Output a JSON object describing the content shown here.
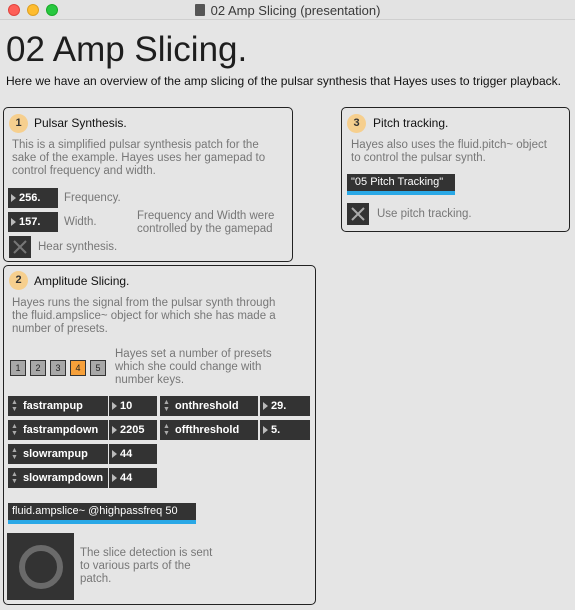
{
  "window": {
    "title": "02 Amp Slicing (presentation)"
  },
  "heading": "02 Amp Slicing.",
  "intro": "Here we have an overview of the amp slicing of the pulsar synthesis that Hayes uses to trigger playback.",
  "panel1": {
    "number": "1",
    "title": "Pulsar Synthesis.",
    "desc": [
      "This is a simplified pulsar synthesis patch for the",
      "sake of the example. Hayes uses her gamepad to",
      "control frequency and width."
    ],
    "frequency_value": "256.",
    "frequency_label": "Frequency.",
    "width_value": "157.",
    "width_label": "Width.",
    "note": [
      "Frequency and Width were",
      "controlled by the gamepad"
    ],
    "hear_label": "Hear synthesis."
  },
  "panel2": {
    "number": "2",
    "title": "Amplitude Slicing.",
    "desc": [
      "Hayes runs the signal from the pulsar synth through",
      "the fluid.ampslice~ object for which she has made a",
      "number of presets."
    ],
    "presets": [
      "1",
      "2",
      "3",
      "4",
      "5"
    ],
    "active_preset": "4",
    "preset_note": [
      "Hayes set a number of presets",
      "which she could change with",
      "number keys."
    ],
    "params": [
      {
        "name": "fastrampup",
        "value": "10"
      },
      {
        "name": "fastrampdown",
        "value": "2205"
      },
      {
        "name": "slowrampup",
        "value": "44"
      },
      {
        "name": "slowrampdown",
        "value": "44"
      },
      {
        "name": "onthreshold",
        "value": "29."
      },
      {
        "name": "offthreshold",
        "value": "5."
      }
    ],
    "object": "fluid.ampslice~ @highpassfreq 50",
    "slice_note": [
      "The slice detection is sent",
      "to various parts of the",
      "patch."
    ]
  },
  "panel3": {
    "number": "3",
    "title": "Pitch tracking.",
    "desc": [
      "Hayes also uses the fluid.pitch~ object",
      "to control the pulsar synth."
    ],
    "message": "\"05 Pitch Tracking\"",
    "toggle_label": "Use pitch tracking."
  },
  "colors": {
    "accent_blue": "#2aa8e6",
    "badge_orange": "#f6cf8e",
    "active_preset": "#f6a03a",
    "object_bg": "#333333"
  }
}
